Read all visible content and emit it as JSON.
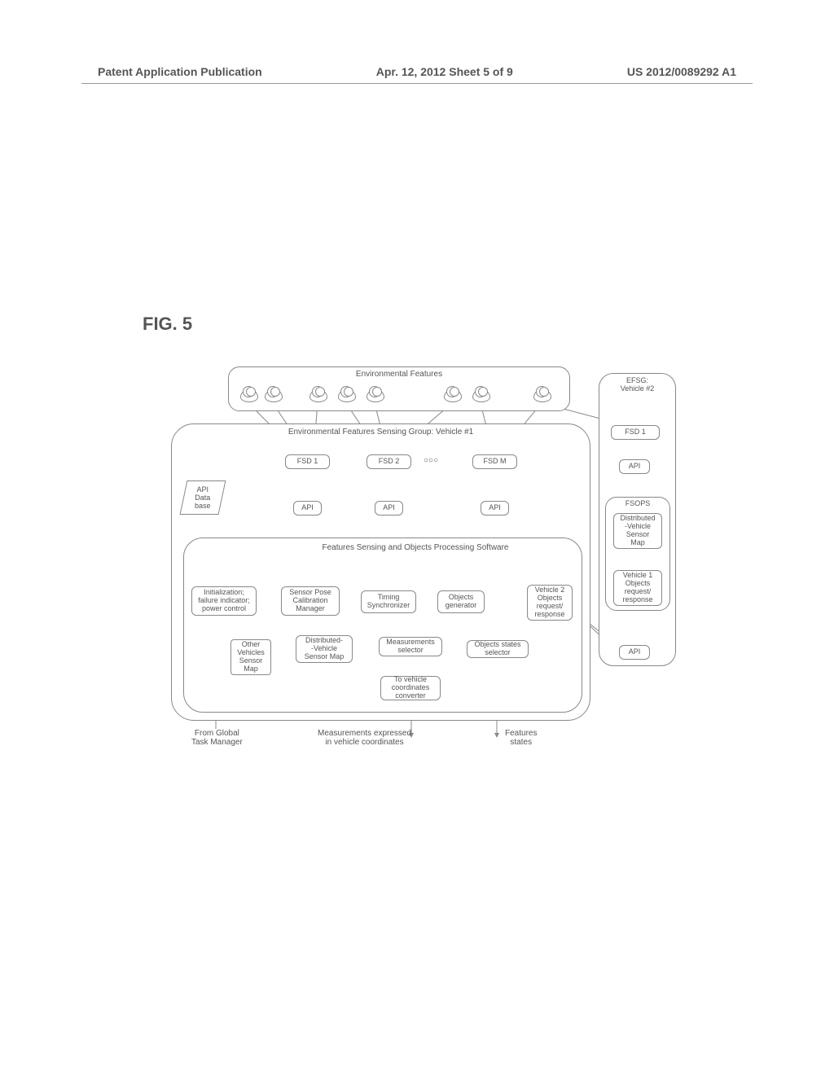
{
  "header": {
    "left": "Patent Application Publication",
    "center": "Apr. 12, 2012  Sheet 5 of 9",
    "right": "US 2012/0089292 A1"
  },
  "figure_label": "FIG. 5",
  "env_features_title": "Environmental Features",
  "vehicle1": {
    "group_title": "Environmental Features Sensing Group: Vehicle #1",
    "fsd": [
      "FSD 1",
      "FSD 2",
      "FSD M"
    ],
    "ellipsis": "○○○",
    "api": "API",
    "api_db": "API\nData\nbase",
    "fsops_title": "Features Sensing and Objects Processing Software",
    "blocks": {
      "init": "Initialization;\nfailure indicator;\npower control",
      "pose": "Sensor Pose\nCalibration\nManager",
      "timing": "Timing\nSynchronizer",
      "objgen": "Objects\ngenerator",
      "v2req": "Vehicle 2\nObjects\nrequest/\nresponse",
      "other_map": "Other\nVehicles\nSensor\nMap",
      "dist_map": "Distributed-\n-Vehicle\nSensor Map",
      "meas_sel": "Measurements\nselector",
      "obj_sel": "Objects states\nselector",
      "coord_conv": "To vehicle\ncoordinates\nconverter"
    },
    "outputs": {
      "gtm": "From Global\nTask Manager",
      "meas": "Measurements expressed\nin vehicle coordinates",
      "feat": "Features\nstates"
    }
  },
  "vehicle2": {
    "title": "EFSG:\nVehicle #2",
    "fsd1": "FSD 1",
    "api": "API",
    "fsops": "FSOPS",
    "dist_map": "Distributed\n-Vehicle\nSensor\nMap",
    "v1req": "Vehicle 1\nObjects\nrequest/\nresponse",
    "api2": "API"
  }
}
